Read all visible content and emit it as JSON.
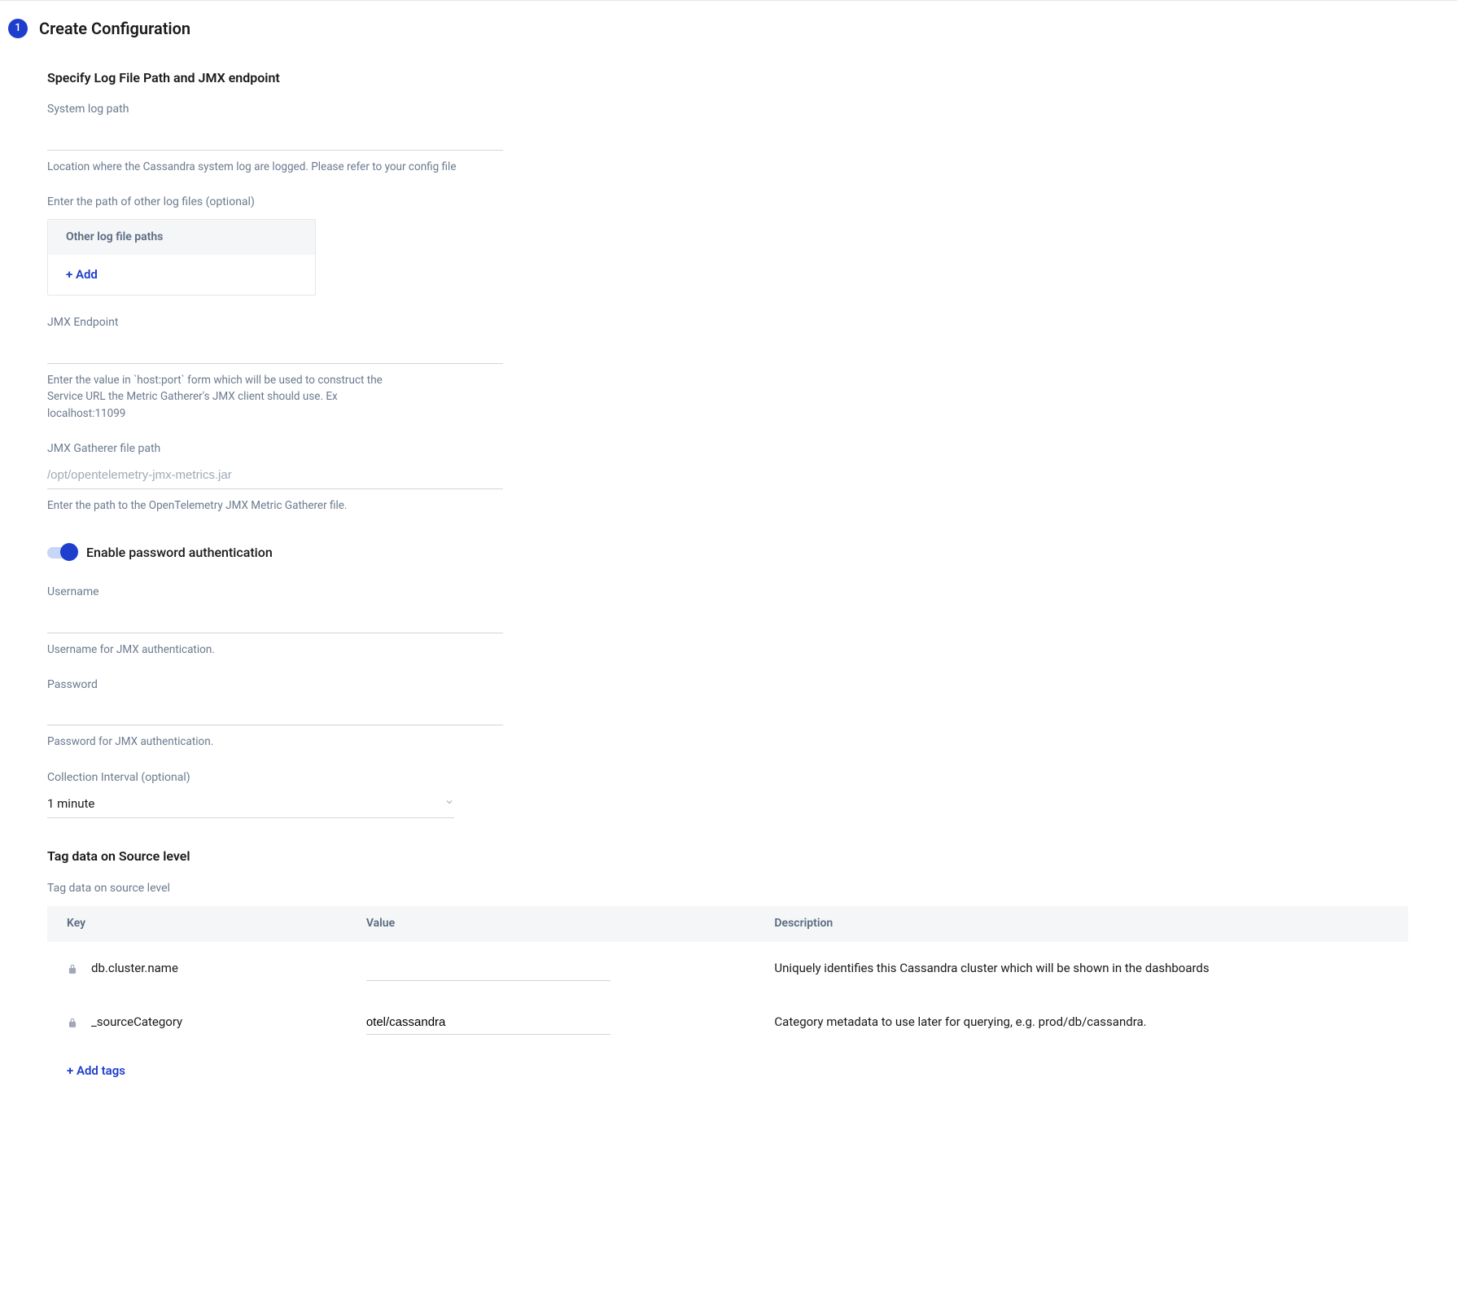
{
  "step": {
    "number": "1",
    "title": "Create Configuration"
  },
  "section1": {
    "title": "Specify Log File Path and JMX endpoint",
    "systemLog": {
      "label": "System log path",
      "value": "",
      "help": "Location where the Cassandra system log are logged. Please refer to your config file"
    },
    "otherLogs": {
      "label": "Enter the path of other log files (optional)",
      "header": "Other log file paths",
      "add": "+ Add"
    },
    "jmxEndpoint": {
      "label": "JMX Endpoint",
      "value": "",
      "help": "Enter the value in `host:port` form which will be used to construct the Service URL the Metric Gatherer's JMX client should use. Ex localhost:11099"
    },
    "jmxGatherer": {
      "label": "JMX Gatherer file path",
      "placeholder": "/opt/opentelemetry-jmx-metrics.jar",
      "value": "",
      "help": "Enter the path to the OpenTelemetry JMX Metric Gatherer file."
    }
  },
  "auth": {
    "toggleLabel": "Enable password authentication",
    "enabled": true,
    "username": {
      "label": "Username",
      "value": "",
      "help": "Username for JMX authentication."
    },
    "password": {
      "label": "Password",
      "value": "",
      "help": "Password for JMX authentication."
    }
  },
  "collectionInterval": {
    "label": "Collection Interval (optional)",
    "value": "1 minute"
  },
  "tagging": {
    "title": "Tag data on Source level",
    "subtitle": "Tag data on source level",
    "headers": {
      "key": "Key",
      "value": "Value",
      "description": "Description"
    },
    "rows": [
      {
        "key": "db.cluster.name",
        "value": "",
        "description": "Uniquely identifies this Cassandra cluster which will be shown in the dashboards"
      },
      {
        "key": "_sourceCategory",
        "value": "otel/cassandra",
        "description": "Category metadata to use later for querying, e.g. prod/db/cassandra."
      }
    ],
    "addTags": "+ Add tags"
  }
}
